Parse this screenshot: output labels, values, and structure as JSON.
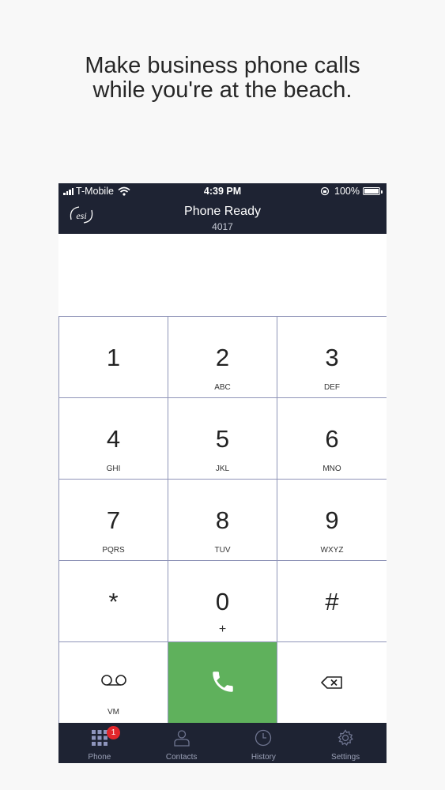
{
  "headline": {
    "line1": "Make business phone calls",
    "line2": "while you're at the beach."
  },
  "status_bar": {
    "carrier": "T-Mobile",
    "time": "4:39 PM",
    "battery": "100%"
  },
  "header": {
    "logo_text": "esi",
    "title": "Phone Ready",
    "extension": "4017"
  },
  "dialer": {
    "display_value": "",
    "keys": [
      {
        "digit": "1",
        "letters": ""
      },
      {
        "digit": "2",
        "letters": "ABC"
      },
      {
        "digit": "3",
        "letters": "DEF"
      },
      {
        "digit": "4",
        "letters": "GHI"
      },
      {
        "digit": "5",
        "letters": "JKL"
      },
      {
        "digit": "6",
        "letters": "MNO"
      },
      {
        "digit": "7",
        "letters": "PQRS"
      },
      {
        "digit": "8",
        "letters": "TUV"
      },
      {
        "digit": "9",
        "letters": "WXYZ"
      },
      {
        "digit": "*",
        "letters": ""
      },
      {
        "digit": "0",
        "letters": "+"
      },
      {
        "digit": "#",
        "letters": ""
      }
    ],
    "voicemail_label": "VM",
    "call_icon": "phone-icon",
    "backspace_icon": "backspace-icon",
    "call_color": "#5fb15c"
  },
  "tab_bar": {
    "tabs": [
      {
        "label": "Phone",
        "icon": "keypad-icon",
        "badge": "1"
      },
      {
        "label": "Contacts",
        "icon": "person-icon"
      },
      {
        "label": "History",
        "icon": "clock-icon"
      },
      {
        "label": "Settings",
        "icon": "gear-icon"
      }
    ]
  }
}
